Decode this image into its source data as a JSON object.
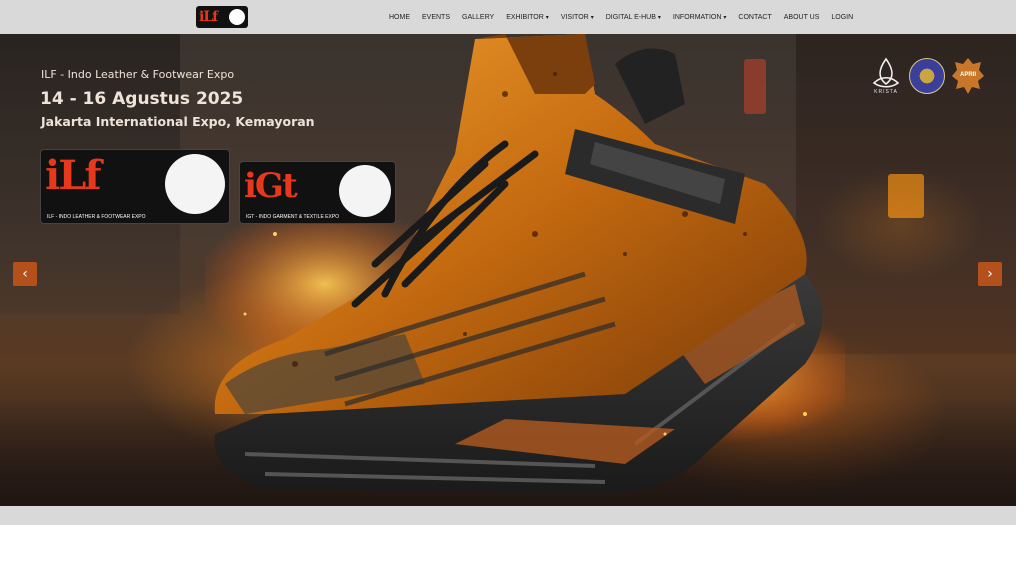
{
  "nav": {
    "logo_text": "iLf",
    "items": [
      {
        "label": "HOME",
        "dropdown": false
      },
      {
        "label": "EVENTS",
        "dropdown": false
      },
      {
        "label": "GALLERY",
        "dropdown": false
      },
      {
        "label": "EXHIBITOR",
        "dropdown": true
      },
      {
        "label": "VISITOR",
        "dropdown": true
      },
      {
        "label": "DIGITAL E-HUB",
        "dropdown": true
      },
      {
        "label": "INFORMATION",
        "dropdown": true
      },
      {
        "label": "CONTACT",
        "dropdown": false
      },
      {
        "label": "ABOUT US",
        "dropdown": false
      },
      {
        "label": "LOGIN",
        "dropdown": false
      }
    ],
    "caret": "▾"
  },
  "hero": {
    "eyebrow": "ILF - Indo Leather & Footwear Expo",
    "date": "14 - 16 Agustus 2025",
    "venue": "Jakarta International Expo, Kemayoran",
    "ilf_logo": {
      "title": "iLf",
      "subtitle": "ILF - INDO LEATHER & FOOTWEAR EXPO"
    },
    "igt_logo": {
      "title": "iGt",
      "subtitle": "IGT - INDO GARMENT & TEXTILE EXPO"
    },
    "partners": {
      "krista": "KRISTA",
      "aprii": "APRII"
    },
    "prev_arrow": "‹",
    "next_arrow": "›"
  },
  "colors": {
    "navbar_bg": "#d9d9d9",
    "accent": "#b4501c",
    "brand_red": "#e8381c"
  }
}
